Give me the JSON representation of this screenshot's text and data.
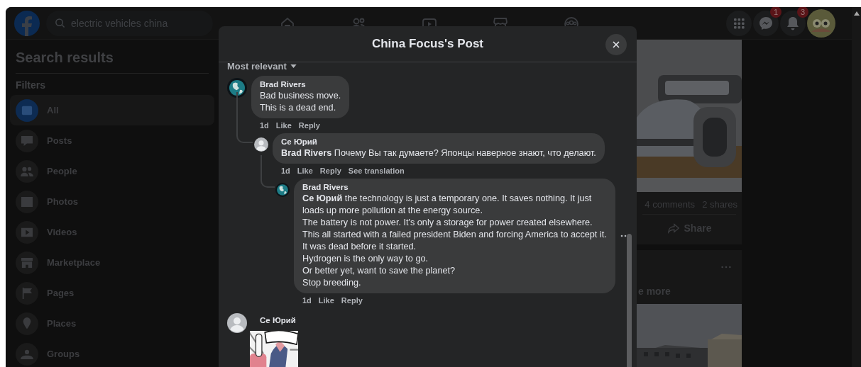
{
  "top_bar": {
    "search": {
      "value": "electric vehicles china"
    },
    "nav": [
      {
        "kind": "home"
      },
      {
        "kind": "friends"
      },
      {
        "kind": "video"
      },
      {
        "kind": "store"
      },
      {
        "kind": "groups"
      }
    ],
    "actions": [
      {
        "kind": "menu"
      },
      {
        "kind": "messenger",
        "badge": "1"
      },
      {
        "kind": "bell",
        "badge": "3"
      },
      {
        "kind": "avatar"
      }
    ]
  },
  "sidebar": {
    "title": "Search results",
    "filters_label": "Filters",
    "items": [
      {
        "label": "All",
        "kind": "all",
        "selected": true
      },
      {
        "label": "Posts",
        "kind": "posts",
        "selected": false
      },
      {
        "label": "People",
        "kind": "people",
        "selected": false
      },
      {
        "label": "Photos",
        "kind": "photos",
        "selected": false
      },
      {
        "label": "Videos",
        "kind": "videos",
        "selected": false
      },
      {
        "label": "Marketplace",
        "kind": "marketplace",
        "selected": false
      },
      {
        "label": "Pages",
        "kind": "pages",
        "selected": false
      },
      {
        "label": "Places",
        "kind": "places",
        "selected": false
      },
      {
        "label": "Groups",
        "kind": "groups",
        "selected": false
      }
    ]
  },
  "feed": {
    "stats": [
      "4 comments",
      "2 shares"
    ],
    "share": "Share",
    "see_more": "e more"
  },
  "modal": {
    "title": "China Focus's Post",
    "sort": "Most relevant",
    "comments": [
      {
        "author": "Brad Rivers",
        "avatar": {
          "kind": "globe"
        },
        "text": "Bad business move.\nThis is a dead end.",
        "actions": [
          "1d",
          "Like",
          "Reply"
        ],
        "children": [
          {
            "author": "Се Юрий",
            "avatar": {
              "kind": "blank"
            },
            "text": "**Brad Rivers** Почему Вы так думаете? Японцы наверное знают, что делают.",
            "actions": [
              "1d",
              "Like",
              "Reply",
              "See translation"
            ],
            "children": [
              {
                "author": "Brad Rivers",
                "avatar": {
                  "kind": "globe"
                },
                "text": "**Се Юрий** the technology is just a temporary one. It saves nothing. It just\nloads up more pollution at the energy source.\nThe battery is not power. It's only a storage for power created elsewhere.\nThis all started with a failed president Biden and forcing America to accept it.\nIt was dead before it started.\nHydrogen is the only way to go.\nOr better yet, want to save the planet?\nStop breeding.",
                "actions": [
                  "1d",
                  "Like",
                  "Reply"
                ],
                "menu": true
              }
            ]
          }
        ]
      },
      {
        "author": "Се Юрий",
        "avatar": {
          "kind": "blank"
        }
      }
    ]
  }
}
